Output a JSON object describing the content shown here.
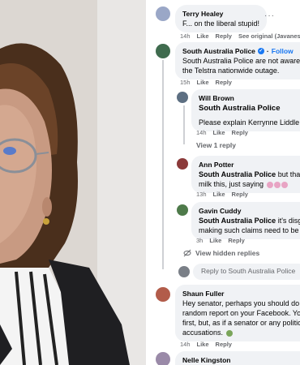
{
  "comments": {
    "terry": {
      "name": "Terry Healey",
      "text": "F... on the liberal stupid!",
      "time": "14h",
      "like": "Like",
      "reply": "Reply",
      "see_original": "See original (Javanese)"
    },
    "sap": {
      "name": "South Australia Police",
      "follow": "Follow",
      "text1": "South Australia Police are not aware of",
      "text2": "the Telstra nationwide outage.",
      "time": "15h",
      "like": "Like",
      "reply": "Reply"
    },
    "will": {
      "name": "Will Brown",
      "mention": "South Australia Police",
      "text": "Please explain Kerrynne Liddle -",
      "time": "14h",
      "like": "Like",
      "reply": "Reply"
    },
    "view1": "View 1 reply",
    "ann": {
      "name": "Ann Potter",
      "mention": "South Australia Police",
      "text_after": " but that do",
      "text2": "milk this, just saying",
      "time": "13h",
      "like": "Like",
      "reply": "Reply"
    },
    "gavin": {
      "name": "Gavin Cuddy",
      "mention": "South Australia Police",
      "text_after": " it's disgust",
      "text2": "making such claims need to be he",
      "time": "3h",
      "like": "Like",
      "reply": "Reply"
    },
    "hidden": "View hidden replies",
    "reply_placeholder": "Reply to South Australia Police",
    "shaun": {
      "name": "Shaun Fuller",
      "text1": "Hey senator, perhaps you should do a",
      "text2": "random report on your Facebook. You'",
      "text3": "first, but, as if a senator or any politicia",
      "text4": "accusations.",
      "time": "14h",
      "like": "Like",
      "reply": "Reply"
    },
    "nelle": {
      "name": "Nelle Kingston"
    }
  },
  "colors": {
    "accent": "#1877f2",
    "bubble": "#f0f2f5",
    "muted": "#65676b"
  }
}
